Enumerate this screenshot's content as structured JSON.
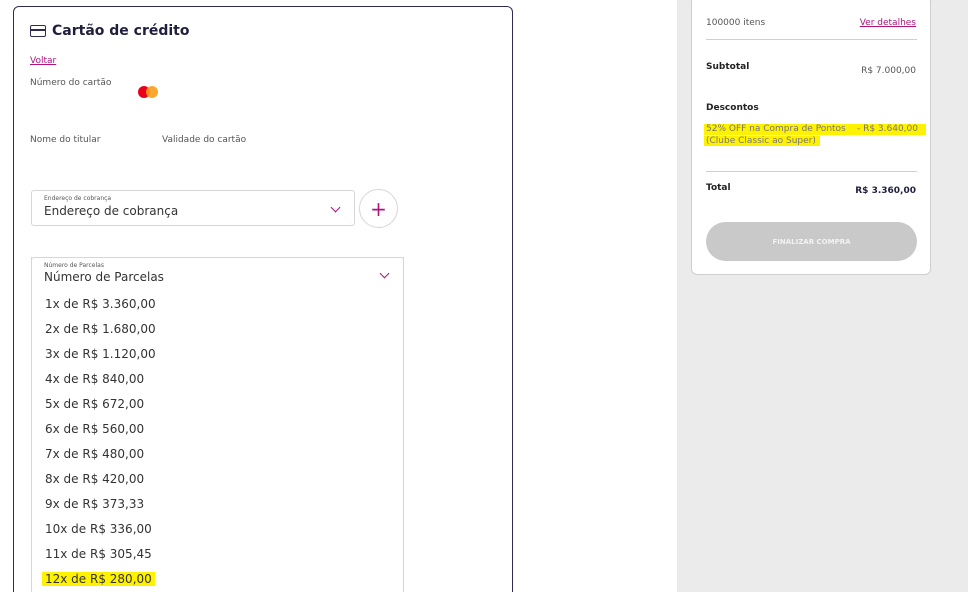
{
  "payment": {
    "title": "Cartão de crédito",
    "back_link": "Voltar",
    "card_number_label": "Número do cartão",
    "holder_label": "Nome do titular",
    "expiry_label": "Validade do cartão",
    "billing_address": {
      "small_label": "Endereço de cobrança",
      "value": "Endereço de cobrança"
    },
    "add_button": "+",
    "installments": {
      "small_label": "Número de Parcelas",
      "value": "Número de Parcelas",
      "options": [
        "1x de R$ 3.360,00",
        "2x de R$ 1.680,00",
        "3x de R$ 1.120,00",
        "4x de R$ 840,00",
        "5x de R$ 672,00",
        "6x de R$ 560,00",
        "7x de R$ 480,00",
        "8x de R$ 420,00",
        "9x de R$ 373,33",
        "10x de R$ 336,00",
        "11x de R$ 305,45",
        "12x de R$ 280,00"
      ],
      "highlighted_option": "12x de R$ 280,00"
    }
  },
  "summary": {
    "items_count": "100000 itens",
    "details_link": "Ver detalhes",
    "subtotal_label": "Subtotal",
    "subtotal_value": "R$ 7.000,00",
    "discounts_label": "Descontos",
    "discount_line1": "52% OFF na Compra de Pontos",
    "discount_value": "- R$ 3.640,00",
    "discount_line2": "(Clube Classic ao Super)",
    "total_label": "Total",
    "total_value": "R$ 3.360,00",
    "finalize_button": "FINALIZAR COMPRA"
  },
  "colors": {
    "accent": "#b0137f",
    "highlight": "#fff200",
    "card_border": "#2c2c54",
    "side_background": "#ebebeb",
    "disabled_button": "#c9c9c9"
  },
  "icons": [
    "credit-card-icon",
    "mastercard-icon",
    "chevron-down-icon",
    "plus-icon"
  ]
}
